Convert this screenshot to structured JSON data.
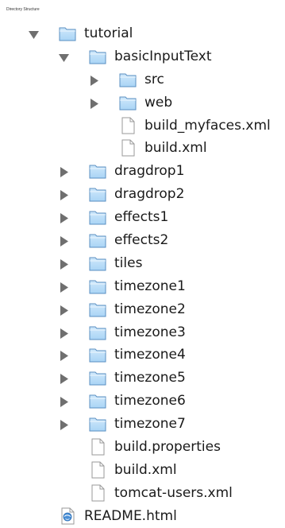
{
  "caption": "Directory Structure",
  "tree": [
    {
      "label": "tutorial",
      "depth": 0,
      "kind": "folder",
      "state": "open"
    },
    {
      "label": "basicInputText",
      "depth": 1,
      "kind": "folder",
      "state": "open"
    },
    {
      "label": "src",
      "depth": 2,
      "kind": "folder",
      "state": "closed"
    },
    {
      "label": "web",
      "depth": 2,
      "kind": "folder",
      "state": "closed"
    },
    {
      "label": "build_myfaces.xml",
      "depth": 2,
      "kind": "file",
      "state": "none"
    },
    {
      "label": "build.xml",
      "depth": 2,
      "kind": "file",
      "state": "none"
    },
    {
      "label": "dragdrop1",
      "depth": 1,
      "kind": "folder",
      "state": "closed"
    },
    {
      "label": "dragdrop2",
      "depth": 1,
      "kind": "folder",
      "state": "closed"
    },
    {
      "label": "effects1",
      "depth": 1,
      "kind": "folder",
      "state": "closed"
    },
    {
      "label": "effects2",
      "depth": 1,
      "kind": "folder",
      "state": "closed"
    },
    {
      "label": "tiles",
      "depth": 1,
      "kind": "folder",
      "state": "closed"
    },
    {
      "label": "timezone1",
      "depth": 1,
      "kind": "folder",
      "state": "closed"
    },
    {
      "label": "timezone2",
      "depth": 1,
      "kind": "folder",
      "state": "closed"
    },
    {
      "label": "timezone3",
      "depth": 1,
      "kind": "folder",
      "state": "closed"
    },
    {
      "label": "timezone4",
      "depth": 1,
      "kind": "folder",
      "state": "closed"
    },
    {
      "label": "timezone5",
      "depth": 1,
      "kind": "folder",
      "state": "closed"
    },
    {
      "label": "timezone6",
      "depth": 1,
      "kind": "folder",
      "state": "closed"
    },
    {
      "label": "timezone7",
      "depth": 1,
      "kind": "folder",
      "state": "closed"
    },
    {
      "label": "build.properties",
      "depth": 1,
      "kind": "file",
      "state": "none"
    },
    {
      "label": "build.xml",
      "depth": 1,
      "kind": "file",
      "state": "none"
    },
    {
      "label": "tomcat-users.xml",
      "depth": 1,
      "kind": "file",
      "state": "none"
    },
    {
      "label": "README.html",
      "depth": 0,
      "kind": "html",
      "state": "none"
    }
  ],
  "colors": {
    "triangle": "#6f6f6f",
    "folder_fill": "#a9d4f5",
    "folder_stroke": "#5a8fc2",
    "file_fill": "#ffffff",
    "file_stroke": "#9a9a9a"
  }
}
